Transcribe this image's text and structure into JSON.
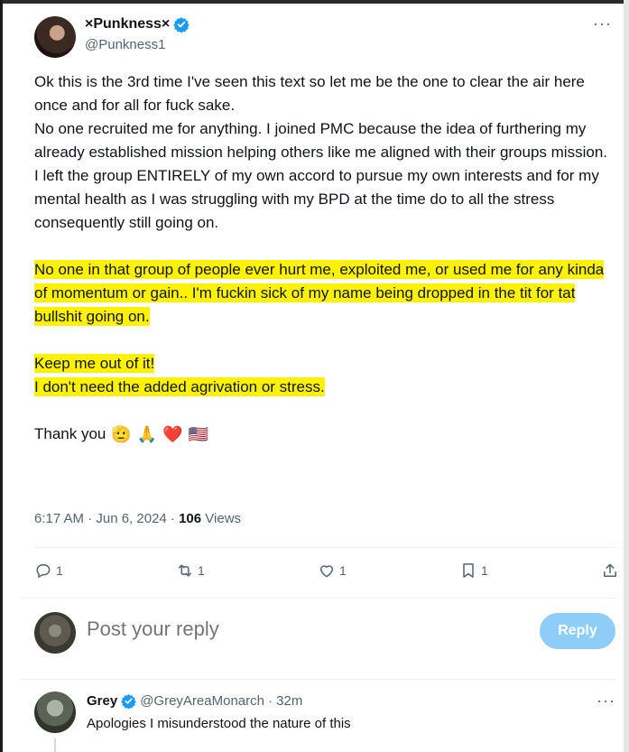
{
  "tweet": {
    "display_name": "×Punkness×",
    "handle": "@Punkness1",
    "more_label": "···",
    "paragraphs": [
      "Ok this is the 3rd time I've seen this text so let me be the one to clear the air here once and for all for fuck sake.",
      "No one recruited me for anything. I joined PMC because the idea of furthering my already established mission helping others like me aligned with their groups mission.",
      "I left the group ENTIRELY of my own accord to pursue my own interests and for my mental health as I was struggling with my BPD at the time do to all the stress consequently still going on."
    ],
    "highlighted_paragraph": "No one in that group of people ever hurt me, exploited me, or used me for any kinda of momentum or gain.. I'm fuckin sick of my name being dropped in the tit for tat bullshit going on.",
    "highlighted_lines": [
      "Keep me out of it!",
      "I don't need the added agrivation or stress."
    ],
    "thanks_text": "Thank you",
    "emojis": [
      "🫡",
      "🙏",
      "❤️",
      "🇺🇸"
    ],
    "timestamp": "6:17 AM · Jun 6, 2024 · ",
    "views_count": "106",
    "views_label": " Views",
    "highlight_color": "#fff200",
    "verified_color": "#1d9bf0"
  },
  "actions": {
    "reply_count": "1",
    "retweet_count": "1",
    "like_count": "1",
    "bookmark_count": "1"
  },
  "compose": {
    "placeholder": "Post your reply",
    "button_label": "Reply",
    "button_color": "#8ecdf7"
  },
  "reply": {
    "display_name": "Grey",
    "handle": "@GreyAreaMonarch",
    "time": "· 32m",
    "text": "Apologies I misunderstood the nature of this",
    "more_label": "···"
  }
}
